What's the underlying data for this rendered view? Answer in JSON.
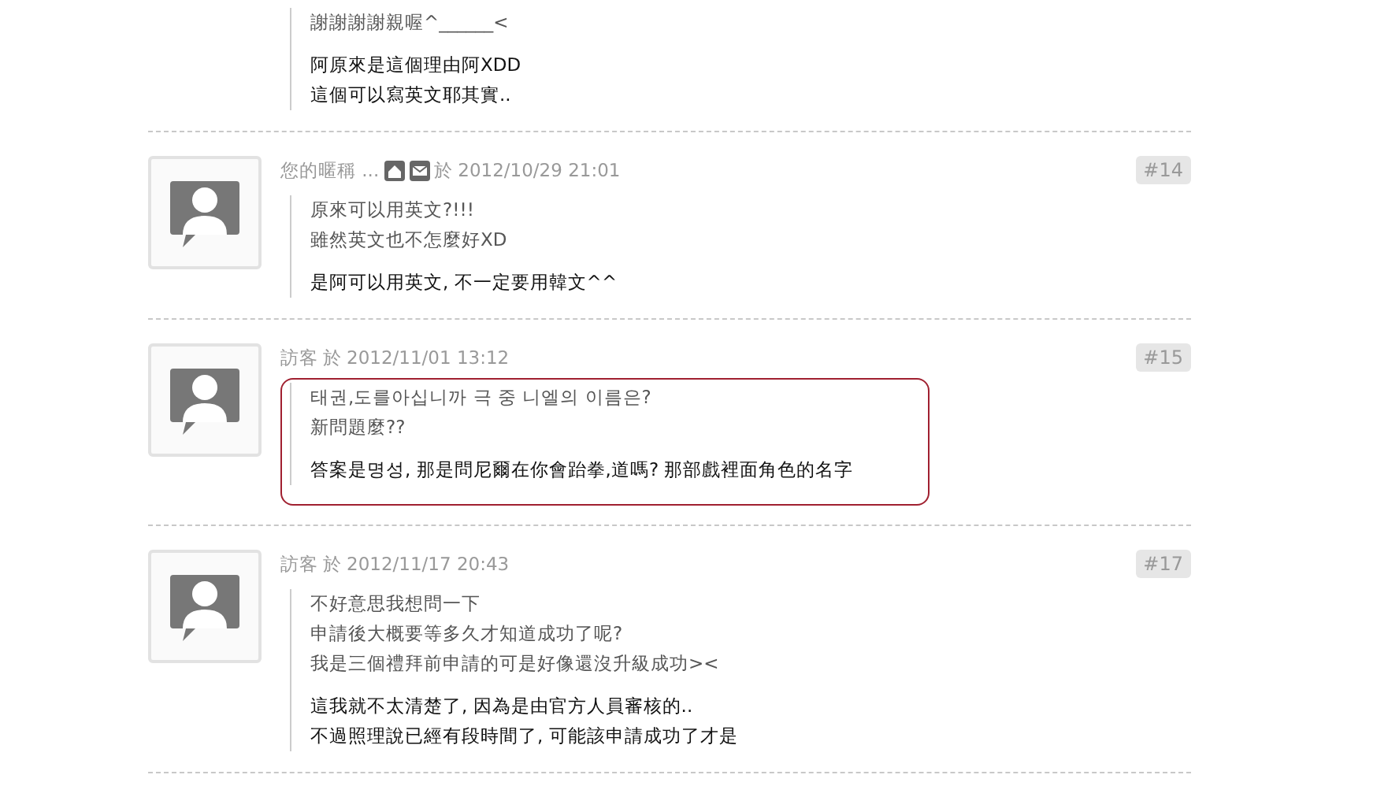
{
  "comments": [
    {
      "kind": "partial",
      "quote": [
        "謝謝謝謝親喔^______<"
      ],
      "reply": [
        "阿原來是這個理由阿XDD",
        "這個可以寫英文耶其實.."
      ]
    },
    {
      "kind": "full",
      "author": "您的暱稱 ...",
      "contact_icons": true,
      "on": "於",
      "time": "2012/10/29 21:01",
      "number": "#14",
      "highlighted": false,
      "quote": [
        "原來可以用英文?!!!",
        "雖然英文也不怎麼好XD"
      ],
      "reply": [
        "是阿可以用英文, 不一定要用韓文^^"
      ]
    },
    {
      "kind": "full",
      "author": "訪客",
      "contact_icons": false,
      "on": "於",
      "time": "2012/11/01 13:12",
      "number": "#15",
      "highlighted": true,
      "quote": [
        "태권,도를아십니까 극 중 니엘의 이름은?",
        "新問題麼??"
      ],
      "reply": [
        "答案是명성, 那是問尼爾在你會跆拳,道嗎? 那部戲裡面角色的名字"
      ]
    },
    {
      "kind": "full",
      "author": "訪客",
      "contact_icons": false,
      "on": "於",
      "time": "2012/11/17 20:43",
      "number": "#17",
      "highlighted": false,
      "quote": [
        "不好意思我想問一下",
        "申請後大概要等多久才知道成功了呢?",
        "我是三個禮拜前申請的可是好像還沒升級成功><"
      ],
      "reply": [
        "這我就不太清楚了, 因為是由官方人員審核的..",
        "不過照理說已經有段時間了, 可能該申請成功了才是"
      ]
    }
  ]
}
